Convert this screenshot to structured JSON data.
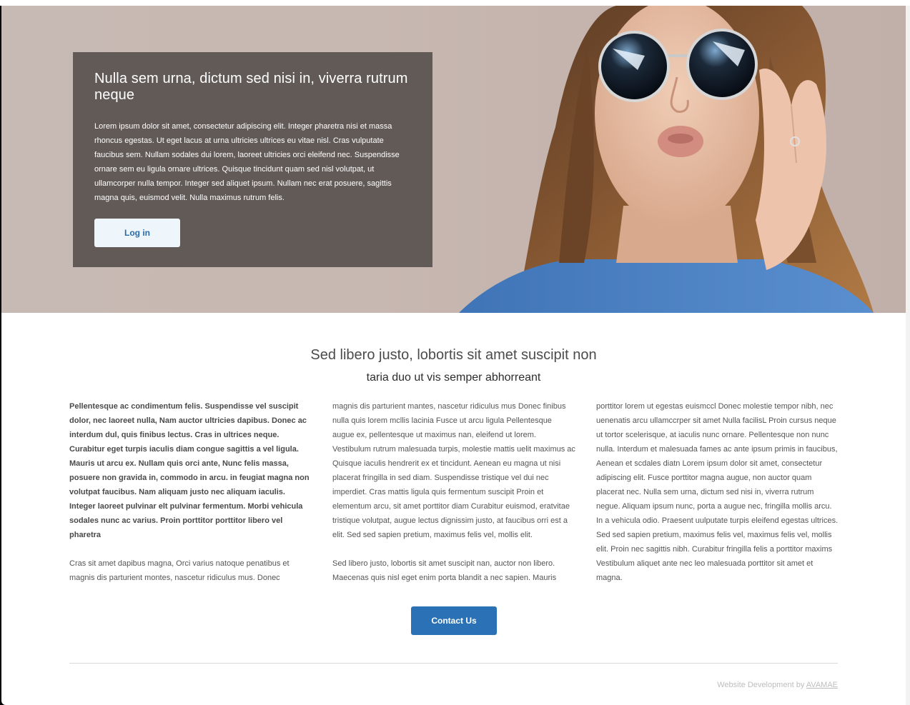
{
  "hero": {
    "title": "Nulla sem urna, dictum sed nisi in, viverra rutrum neque",
    "body": "Lorem ipsum dolor sit amet, consectetur adipiscing elit. Integer pharetra nisi et massa rhoncus egestas. Ut eget lacus at urna ultricies ultrices eu vitae nisl. Cras vulputate faucibus sem. Nullam sodales dui lorem, laoreet ultricies orci eleifend nec. Suspendisse ornare sem eu ligula ornare ultrices. Quisque tincidunt quam sed nisl volutpat, ut ullamcorper nulla tempor. Integer sed aliquet ipsum. Nullam nec erat posuere, sagittis magna quis, euismod velit. Nulla maximus rutrum felis.",
    "login_label": "Log in"
  },
  "section": {
    "title": "Sed libero justo, lobortis sit amet suscipit non",
    "subtitle": "taria duo ut vis semper abhorreant"
  },
  "columns": {
    "col1_bold": "Pellentesque ac condimentum felis. Suspendisse vel suscipit dolor, nec laoreet nulla, Nam auctor ultricies dapibus. Donec ac interdum dul, quis finibus lectus. Cras in ultrices neque. Curabitur eget turpis iaculis diam congue sagittis a vel ligula. Mauris ut arcu ex. Nullam quis orci ante, Nunc felis massa, posuere non gravida in, commodo in arcu. in feugiat magna non volutpat faucibus. Nam aliquam justo nec aliquam iaculis. Integer laoreet pulvinar elt pulvinar fermentum. Morbi vehicula sodales nunc ac varius. Proin porttitor porttitor libero vel pharetra",
    "col1_normal": "Cras sit amet dapibus magna, Orci varius natoque penatibus et magnis dis parturient montes, nascetur ridiculus mus. Donec",
    "col2_p1": "magnis dis parturient mantes, nascetur ridiculus mus Donec finibus nulla quis lorem mcllis lacinia Fusce ut arcu ligula Pellentesque augue ex, pellentesque ut maximus nan, eleifend ut lorem. Vestibulum rutrum malesuada turpis, molestie mattis uelit maximus ac Quisque iaculis hendrerit ex et tincidunt. Aenean eu magna ut nisi placerat fringilla in sed diam. Suspendisse tristique vel dui nec imperdiet. Cras mattis ligula quis fermentum suscipit Proin et elementum arcu, sit amet porttitor diam Curabitur euismod, eratvitae tristique volutpat, augue lectus dignissim justo, at faucibus orri est a elit. Sed sed sapien pretium, maximus felis vel, mollis elit.",
    "col2_p2": "Sed libero justo, lobortis sit amet suscipit nan, auctor non libero. Maecenas quis nisl eget enim porta blandit a nec sapien. Mauris",
    "col3_p1": "porttitor lorem ut egestas euismccl Donec molestie tempor nibh, nec uenenatis arcu ullamccrper sit amet Nulla facilisL Proin cursus neque ut tortor scelerisque, at iaculis nunc ornare. Pellentesque non nunc nulla. Interdum et malesuada fames ac ante ipsum primis in faucibus, Aenean et scdales diatn Lorem ipsum dolor sit amet, consectetur adipiscing elit. Fusce porttitor magna augue, non auctor quam placerat nec. Nulla sem urna, dictum sed nisi in, viverra rutrum negue. Aliquam ipsum nunc, porta a augue nec, fringilla mollis arcu. In a vehicula odio. Praesent uulputate turpis eleifend egestas ultrices. Sed sed sapien pretium, maximus felis vel, maximus felis vel, mollis elit. Proin nec sagittis nibh. Curabitur fringilla felis a porttitor maxims Vestibulum aliquet ante nec leo malesuada porttitor sit amet et magna."
  },
  "contact_label": "Contact Us",
  "footer": {
    "prefix": "Website Development by",
    "link": "AVAMAE"
  },
  "colors": {
    "hero_card": "#625a57",
    "primary_button": "#2a72b5",
    "login_button": "#eef5fb"
  }
}
